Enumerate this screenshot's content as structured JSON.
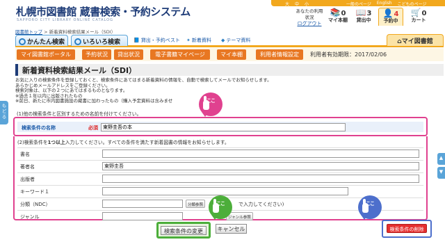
{
  "header": {
    "logo_title": "札幌市図書館 蔵書検索・予約システム",
    "logo_sub": "SAPPORO CITY LIBRARY ONLINE CATALOG",
    "font_size": {
      "large": "大",
      "medium": "中",
      "small": "小"
    },
    "top_links": [
      "一般のページ",
      "English",
      "こどものページ"
    ],
    "login_status": "あなたの利用状況",
    "logout": "ログアウト",
    "icons": [
      {
        "icon": "books-icon",
        "count": "0",
        "label": "マイ本棚"
      },
      {
        "icon": "book-stack-icon",
        "count": "3",
        "label": "貸出中"
      },
      {
        "icon": "person-icon",
        "count": "4",
        "label": "予約中"
      },
      {
        "icon": "cart-icon",
        "count": "0",
        "label": "カート"
      }
    ]
  },
  "breadcrumb": {
    "home": "図書館トップ",
    "separator": ">",
    "current": "新着資料検索結果メール（SDI）"
  },
  "tabs": {
    "simple": "かんたん検索",
    "various": "いろいろ検索",
    "best_borrowed": "貸出・予約ベスト",
    "new_materials": "新着資料",
    "theme_materials": "テーマ資料",
    "my_library": "マイ図書館"
  },
  "nav": {
    "buttons": [
      "マイ図書館ポータル",
      "予約状況",
      "貸出状況",
      "電子書籍マイページ",
      "マイ本棚",
      "利用者情報設定"
    ],
    "expiry": "利用者有効期限：2017/02/06"
  },
  "page_title": "新着資料検索結果メール（SDI）",
  "description": [
    "お気に入りの検索条件を登録しておくと、検索条件にあてはまる新着資料の情報を、自動で検索してメールでお知らせします。",
    "あらかじめメールアドレスをご登録ください。",
    "検索対象は、以下の２つにあてはまるものとなります。",
    "※過去１年以内に出版されたもの",
    "※前日、新たに市内図書施設の蔵書に加わったもの（購入予定資料は含みませ"
  ],
  "section1": "(1)他の検索条件と区別するための名前を付けてください。",
  "condition_name": {
    "label": "検索条件の名称",
    "required": "必須",
    "value": "東野圭吾の本"
  },
  "section2": {
    "prefix": "(2)検索条件を",
    "emphasis": "1つ以上",
    "suffix": "入力してください。すべての条件を満たす新着図書の情報をお知らせします。"
  },
  "fields": [
    {
      "label": "書名",
      "value": ""
    },
    {
      "label": "著者名",
      "value": "東野圭吾"
    },
    {
      "label": "出版者",
      "value": ""
    },
    {
      "label": "キーワード１",
      "value": ""
    },
    {
      "label": "分類（NDC）",
      "value": "",
      "button": "分類参照",
      "note": "で入力してください)"
    },
    {
      "label": "ジャンル",
      "value": "",
      "button": "ジャンル参照"
    }
  ],
  "buttons": {
    "search_change": "検索条件の変更",
    "cancel": "キャンセル",
    "delete": "検索条件の削除"
  },
  "callout_text": "ここ",
  "side_tab": "もどる",
  "colors": {
    "accent_orange": "#e87722",
    "highlight_pink": "#e0418f",
    "highlight_green": "#4cae3a",
    "highlight_blue": "#4d6fcc",
    "danger_red": "#e52f2f"
  }
}
